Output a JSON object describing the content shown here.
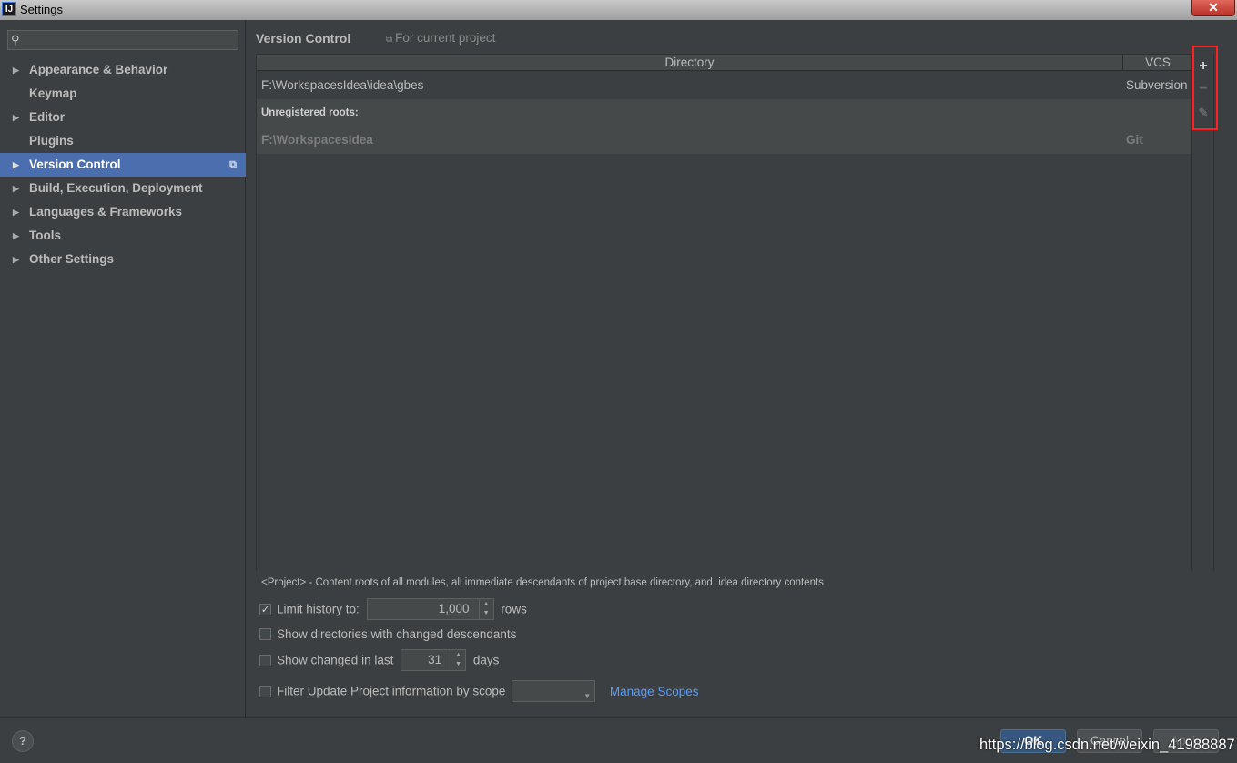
{
  "window": {
    "title": "Settings",
    "app_icon_text": "IJ",
    "close_glyph": "✕"
  },
  "search": {
    "placeholder": "",
    "icon": "search-icon"
  },
  "sidebar": {
    "items": [
      {
        "label": "Appearance & Behavior",
        "expandable": true,
        "active": false
      },
      {
        "label": "Keymap",
        "expandable": false,
        "active": false
      },
      {
        "label": "Editor",
        "expandable": true,
        "active": false
      },
      {
        "label": "Plugins",
        "expandable": false,
        "active": false
      },
      {
        "label": "Version Control",
        "expandable": true,
        "active": true
      },
      {
        "label": "Build, Execution, Deployment",
        "expandable": true,
        "active": false
      },
      {
        "label": "Languages & Frameworks",
        "expandable": true,
        "active": false
      },
      {
        "label": "Tools",
        "expandable": true,
        "active": false
      },
      {
        "label": "Other Settings",
        "expandable": true,
        "active": false
      }
    ]
  },
  "main": {
    "title": "Version Control",
    "scope_note": "For current project",
    "table": {
      "columns": [
        "Directory",
        "VCS"
      ],
      "rows": [
        {
          "directory": "F:\\WorkspacesIdea\\idea\\gbes",
          "vcs": "Subversion"
        }
      ],
      "unregistered_header": "Unregistered roots:",
      "unregistered_rows": [
        {
          "directory": "F:\\WorkspacesIdea",
          "vcs": "Git"
        }
      ]
    },
    "toolbar": {
      "add": "+",
      "remove": "−",
      "edit": "✎"
    },
    "note": "<Project> - Content roots of all modules, all immediate descendants of project base directory, and .idea directory contents",
    "options": {
      "limit_history": {
        "label": "Limit history to:",
        "checked": true,
        "value": "1,000",
        "suffix": "rows"
      },
      "show_dirs": {
        "label": "Show directories with changed descendants",
        "checked": false
      },
      "show_changed": {
        "label": "Show changed in last",
        "checked": false,
        "value": "31",
        "suffix": "days"
      },
      "filter_scope": {
        "label": "Filter Update Project information by scope",
        "checked": false,
        "selected": ""
      },
      "manage_scopes": "Manage Scopes"
    }
  },
  "footer": {
    "help": "?",
    "ok": "OK",
    "cancel": "Cancel",
    "apply": "Apply",
    "watermark": "https://blog.csdn.net/weixin_41988887"
  },
  "colors": {
    "accent": "#4b6eaf",
    "link": "#589df6",
    "highlight": "#ff2020"
  }
}
